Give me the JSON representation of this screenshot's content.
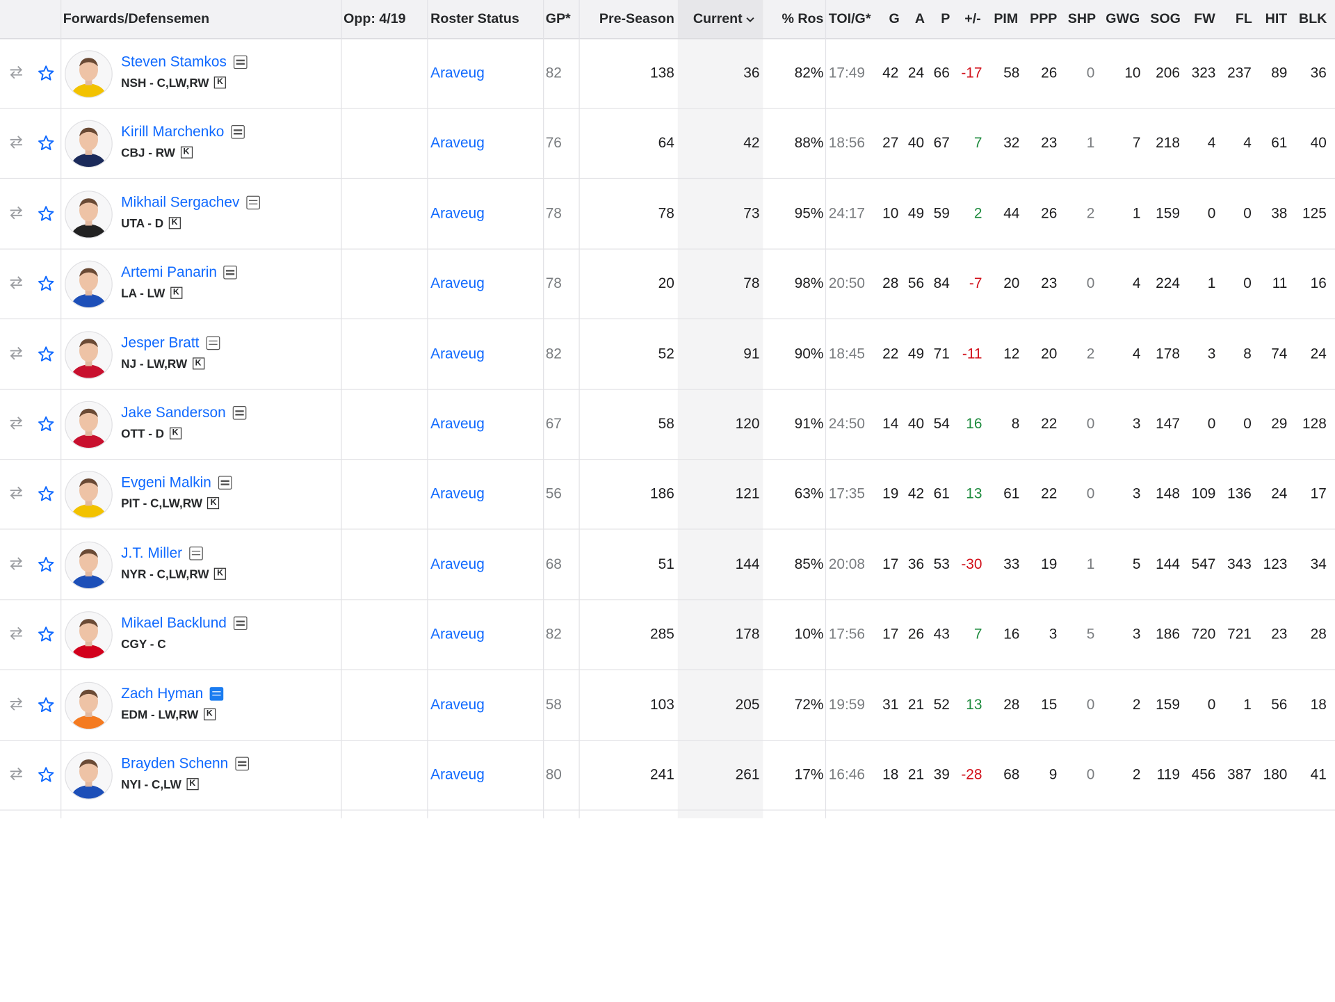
{
  "header": {
    "players": "Forwards/Defensemen",
    "opp": "Opp: 4/19",
    "roster_status": "Roster Status",
    "gp": "GP*",
    "preseason": "Pre-Season",
    "current": "Current",
    "pct_ros": "% Ros",
    "toi": "TOI/G*",
    "g": "G",
    "a": "A",
    "p": "P",
    "pm": "+/-",
    "pim": "PIM",
    "ppp": "PPP",
    "shp": "SHP",
    "gwg": "GWG",
    "sog": "SOG",
    "fw": "FW",
    "fl": "FL",
    "hit": "HIT",
    "blk": "BLK"
  },
  "icons": {
    "swap": "swap-arrows-icon",
    "star": "star-icon",
    "note": "notes-icon",
    "keeper": "keeper-badge-icon",
    "sort": "chevron-down-icon"
  },
  "colors": {
    "link": "#0f69ff",
    "positive": "#1c8a3c",
    "negative": "#d1101a"
  },
  "rows": [
    {
      "name": "Steven Stamkos",
      "team": "NSH - C,LW,RW",
      "keeper": "K",
      "note": "normal",
      "status": "Araveug",
      "gp": "82",
      "pre": "138",
      "cur": "36",
      "ros": "82%",
      "toi": "17:49",
      "g": "42",
      "a": "24",
      "p": "66",
      "pm": "-17",
      "pim": "58",
      "ppp": "26",
      "shp": "0",
      "gwg": "10",
      "sog": "206",
      "fw": "323",
      "fl": "237",
      "hit": "89",
      "blk": "36",
      "jersey": "#f2c200"
    },
    {
      "name": "Kirill Marchenko",
      "team": "CBJ - RW",
      "keeper": "K",
      "note": "normal",
      "status": "Araveug",
      "gp": "76",
      "pre": "64",
      "cur": "42",
      "ros": "88%",
      "toi": "18:56",
      "g": "27",
      "a": "40",
      "p": "67",
      "pm": "7",
      "pim": "32",
      "ppp": "23",
      "shp": "1",
      "gwg": "7",
      "sog": "218",
      "fw": "4",
      "fl": "4",
      "hit": "61",
      "blk": "40",
      "jersey": "#1b2a5a"
    },
    {
      "name": "Mikhail Sergachev",
      "team": "UTA - D",
      "keeper": "K",
      "note": "normal",
      "status": "Araveug",
      "gp": "78",
      "pre": "78",
      "cur": "73",
      "ros": "95%",
      "toi": "24:17",
      "g": "10",
      "a": "49",
      "p": "59",
      "pm": "2",
      "pim": "44",
      "ppp": "26",
      "shp": "2",
      "gwg": "1",
      "sog": "159",
      "fw": "0",
      "fl": "0",
      "hit": "38",
      "blk": "125",
      "jersey": "#222222"
    },
    {
      "name": "Artemi Panarin",
      "team": "LA - LW",
      "keeper": "K",
      "note": "normal",
      "status": "Araveug",
      "gp": "78",
      "pre": "20",
      "cur": "78",
      "ros": "98%",
      "toi": "20:50",
      "g": "28",
      "a": "56",
      "p": "84",
      "pm": "-7",
      "pim": "20",
      "ppp": "23",
      "shp": "0",
      "gwg": "4",
      "sog": "224",
      "fw": "1",
      "fl": "0",
      "hit": "11",
      "blk": "16",
      "jersey": "#1d4fb8"
    },
    {
      "name": "Jesper Bratt",
      "team": "NJ - LW,RW",
      "keeper": "K",
      "note": "normal",
      "status": "Araveug",
      "gp": "82",
      "pre": "52",
      "cur": "91",
      "ros": "90%",
      "toi": "18:45",
      "g": "22",
      "a": "49",
      "p": "71",
      "pm": "-11",
      "pim": "12",
      "ppp": "20",
      "shp": "2",
      "gwg": "4",
      "sog": "178",
      "fw": "3",
      "fl": "8",
      "hit": "74",
      "blk": "24",
      "jersey": "#c8102e"
    },
    {
      "name": "Jake Sanderson",
      "team": "OTT - D",
      "keeper": "K",
      "note": "normal",
      "status": "Araveug",
      "gp": "67",
      "pre": "58",
      "cur": "120",
      "ros": "91%",
      "toi": "24:50",
      "g": "14",
      "a": "40",
      "p": "54",
      "pm": "16",
      "pim": "8",
      "ppp": "22",
      "shp": "0",
      "gwg": "3",
      "sog": "147",
      "fw": "0",
      "fl": "0",
      "hit": "29",
      "blk": "128",
      "jersey": "#c8102e"
    },
    {
      "name": "Evgeni Malkin",
      "team": "PIT - C,LW,RW",
      "keeper": "K",
      "note": "normal",
      "status": "Araveug",
      "gp": "56",
      "pre": "186",
      "cur": "121",
      "ros": "63%",
      "toi": "17:35",
      "g": "19",
      "a": "42",
      "p": "61",
      "pm": "13",
      "pim": "61",
      "ppp": "22",
      "shp": "0",
      "gwg": "3",
      "sog": "148",
      "fw": "109",
      "fl": "136",
      "hit": "24",
      "blk": "17",
      "jersey": "#f2c200"
    },
    {
      "name": "J.T. Miller",
      "team": "NYR - C,LW,RW",
      "keeper": "K",
      "note": "normal",
      "status": "Araveug",
      "gp": "68",
      "pre": "51",
      "cur": "144",
      "ros": "85%",
      "toi": "20:08",
      "g": "17",
      "a": "36",
      "p": "53",
      "pm": "-30",
      "pim": "33",
      "ppp": "19",
      "shp": "1",
      "gwg": "5",
      "sog": "144",
      "fw": "547",
      "fl": "343",
      "hit": "123",
      "blk": "34",
      "jersey": "#1d4fb8"
    },
    {
      "name": "Mikael Backlund",
      "team": "CGY - C",
      "keeper": "",
      "note": "normal",
      "status": "Araveug",
      "gp": "82",
      "pre": "285",
      "cur": "178",
      "ros": "10%",
      "toi": "17:56",
      "g": "17",
      "a": "26",
      "p": "43",
      "pm": "7",
      "pim": "16",
      "ppp": "3",
      "shp": "5",
      "gwg": "3",
      "sog": "186",
      "fw": "720",
      "fl": "721",
      "hit": "23",
      "blk": "28",
      "jersey": "#d2001c"
    },
    {
      "name": "Zach Hyman",
      "team": "EDM - LW,RW",
      "keeper": "K",
      "note": "blue",
      "status": "Araveug",
      "gp": "58",
      "pre": "103",
      "cur": "205",
      "ros": "72%",
      "toi": "19:59",
      "g": "31",
      "a": "21",
      "p": "52",
      "pm": "13",
      "pim": "28",
      "ppp": "15",
      "shp": "0",
      "gwg": "2",
      "sog": "159",
      "fw": "0",
      "fl": "1",
      "hit": "56",
      "blk": "18",
      "jersey": "#f47a20"
    },
    {
      "name": "Brayden Schenn",
      "team": "NYI - C,LW",
      "keeper": "K",
      "note": "normal",
      "status": "Araveug",
      "gp": "80",
      "pre": "241",
      "cur": "261",
      "ros": "17%",
      "toi": "16:46",
      "g": "18",
      "a": "21",
      "p": "39",
      "pm": "-28",
      "pim": "68",
      "ppp": "9",
      "shp": "0",
      "gwg": "2",
      "sog": "119",
      "fw": "456",
      "fl": "387",
      "hit": "180",
      "blk": "41",
      "jersey": "#1d4fb8"
    }
  ]
}
